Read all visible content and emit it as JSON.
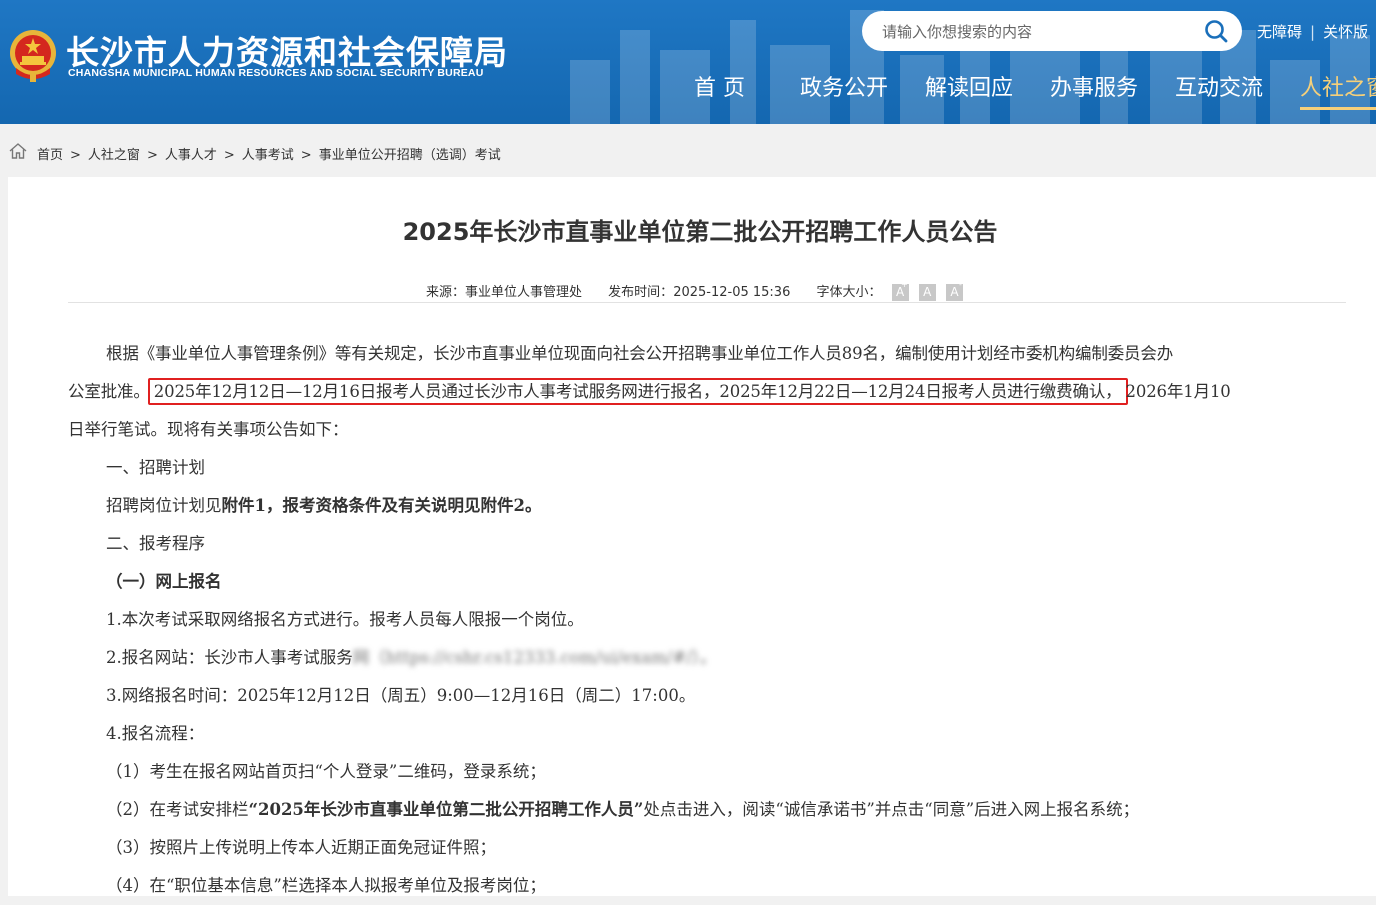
{
  "header": {
    "title": "长沙市人力资源和社会保障局",
    "subtitle": "CHANGSHA MUNICIPAL HUMAN RESOURCES AND SOCIAL SECURITY BUREAU",
    "search_placeholder": "请输入你想搜索的内容",
    "top_links": [
      "无障碍",
      "关怀版"
    ],
    "nav": [
      "首 页",
      "政务公开",
      "解读回应",
      "办事服务",
      "互动交流",
      "人社之窗"
    ],
    "active_nav": "人社之窗",
    "colors": {
      "bar": "#1a6fba",
      "active": "#f6d07a"
    }
  },
  "breadcrumb": [
    "首页",
    "人社之窗",
    "人事人才",
    "人事考试",
    "事业单位公开招聘（选调）考试"
  ],
  "article": {
    "title": "2025年长沙市直事业单位第二批公开招聘工作人员公告",
    "source_label": "来源：",
    "source": "事业单位人事管理处",
    "time_label": "发布时间：",
    "time": "2025-12-05 15:36",
    "font_size_label": "字体大小：",
    "font_buttons": [
      "A",
      "A",
      "A"
    ],
    "p1_line1": "根据《事业单位人事管理条例》等有关规定，长沙市直事业单位现面向社会公开招聘事业单位工作人员89名，编制使用计划经市委机构编制委员会办",
    "p1_line2_pre": "公室批准。",
    "p1_line2_highlight": "2025年12月12日—12月16日报考人员通过长沙市人事考试服务网进行报名，2025年12月22日—12月24日报考人员进行缴费确认，",
    "p1_line2_post": "2026年1月10",
    "p1_line3": "日举行笔试。现将有关事项公告如下：",
    "s1_heading": "一、招聘计划",
    "s1_text_plain": "招聘岗位计划见",
    "s1_text_bold": "附件1，报考资格条件及有关说明见附件2。",
    "s2_heading": "二、报考程序",
    "s2_sub1": "（一）网上报名",
    "item1": "1.本次考试采取网络报名方式进行。报考人员每人限报一个岗位。",
    "item2_text": "2.报名网站：长沙市人事考试服务",
    "item2_blurred": "网（https://cshr.cs12333.com/ui/exam/#/）。",
    "item3": "3.网络报名时间：2025年12月12日（周五）9:00—12月16日（周二）17:00。",
    "item4": "4.报名流程：",
    "step1": "（1）考生在报名网站首页扫“个人登录”二维码，登录系统；",
    "step2_pre": "（2）在考试安排栏",
    "step2_bold": "“2025年长沙市直事业单位第二批公开招聘工作人员”",
    "step2_post": "处点击进入，阅读“诚信承诺书”并点击“同意”后进入网上报名系统；",
    "step3": "（3）按照片上传说明上传本人近期正面免冠证件照；",
    "step4": "（4）在“职位基本信息”栏选择本人拟报考单位及报考岗位；",
    "highlight_color": "#e02020"
  }
}
